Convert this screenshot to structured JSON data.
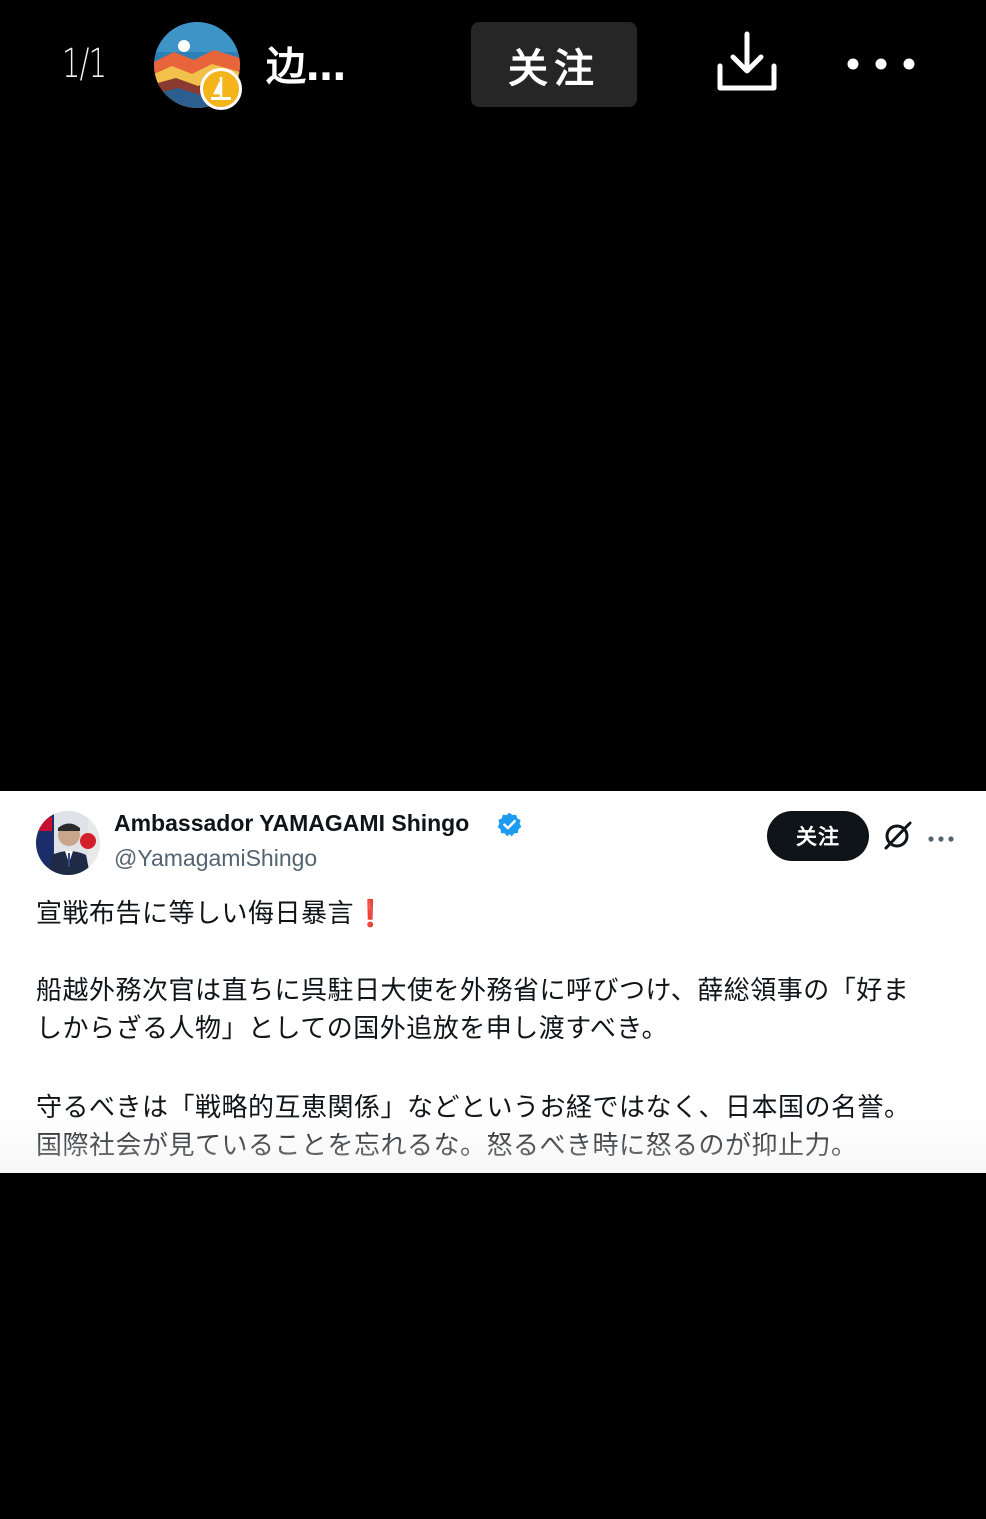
{
  "viewer": {
    "counter": "1/1",
    "username": "边…",
    "follow_label": "关注",
    "icons": {
      "download": "download-icon",
      "more": "more-horizontal-icon"
    }
  },
  "tweet": {
    "author_name": "Ambassador YAMAGAMI Shingo",
    "handle": "@YamagamiShingo",
    "follow_label": "关注",
    "paragraph1": "宣戦布告に等しい侮日暴言",
    "paragraph1_emoji": "❗",
    "paragraph2_line1": "船越外務次官は直ちに呉駐日大使を外務省に呼びつけ、薛総領事の「好ま",
    "paragraph2_line2": "しからざる人物」としての国外追放を申し渡すべき。",
    "paragraph3_line1": "守るべきは「戦略的互恵関係」などというお経ではなく、日本国の名誉。",
    "paragraph3_line2": "国際社会が見ていることを忘れるな。怒るべき時に怒るのが抑止力。",
    "icons": {
      "verified": "verified-badge-icon",
      "grok": "grok-icon",
      "more": "more-horizontal-icon"
    }
  },
  "colors": {
    "background": "#000000",
    "card_background": "#ffffff",
    "verified_blue": "#1d9bf0",
    "follow_button_dark": "#262626",
    "emoji_red": "#c0203a"
  }
}
